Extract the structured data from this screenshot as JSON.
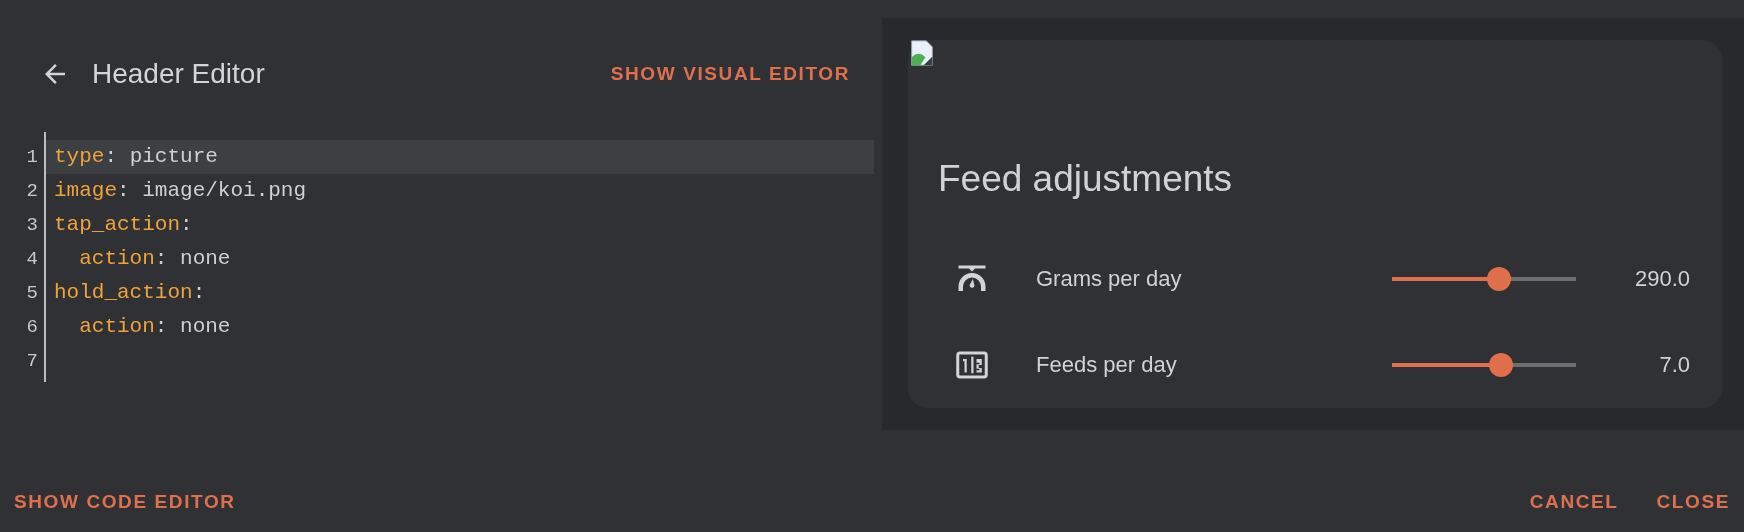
{
  "header": {
    "title": "Header Editor",
    "toggle_button": "SHOW VISUAL EDITOR"
  },
  "code_editor": {
    "lines": [
      {
        "number": "1",
        "active": true,
        "tokens": [
          {
            "kind": "key",
            "text": "type"
          },
          {
            "kind": "plain",
            "text": ": picture"
          }
        ]
      },
      {
        "number": "2",
        "active": false,
        "tokens": [
          {
            "kind": "key",
            "text": "image"
          },
          {
            "kind": "plain",
            "text": ": image/koi.png"
          }
        ]
      },
      {
        "number": "3",
        "active": false,
        "tokens": [
          {
            "kind": "key",
            "text": "tap_action"
          },
          {
            "kind": "plain",
            "text": ":"
          }
        ]
      },
      {
        "number": "4",
        "active": false,
        "tokens": [
          {
            "kind": "key",
            "text": "  action"
          },
          {
            "kind": "plain",
            "text": ": none"
          }
        ]
      },
      {
        "number": "5",
        "active": false,
        "tokens": [
          {
            "kind": "key",
            "text": "hold_action"
          },
          {
            "kind": "plain",
            "text": ":"
          }
        ]
      },
      {
        "number": "6",
        "active": false,
        "tokens": [
          {
            "kind": "key",
            "text": "  action"
          },
          {
            "kind": "plain",
            "text": ": none"
          }
        ]
      },
      {
        "number": "7",
        "active": false
      }
    ]
  },
  "preview_card": {
    "title": "Feed adjustments",
    "rows": [
      {
        "kind": "scale",
        "label": "Grams per day",
        "level": 0.58,
        "reading": "290.0"
      },
      {
        "kind": "counter",
        "label": "Feeds per day",
        "level": 0.59,
        "reading": "7.0"
      }
    ]
  },
  "footer": {
    "left_buttons": [
      "SHOW CODE EDITOR"
    ],
    "right_buttons": [
      "CANCEL",
      "CLOSE"
    ]
  }
}
